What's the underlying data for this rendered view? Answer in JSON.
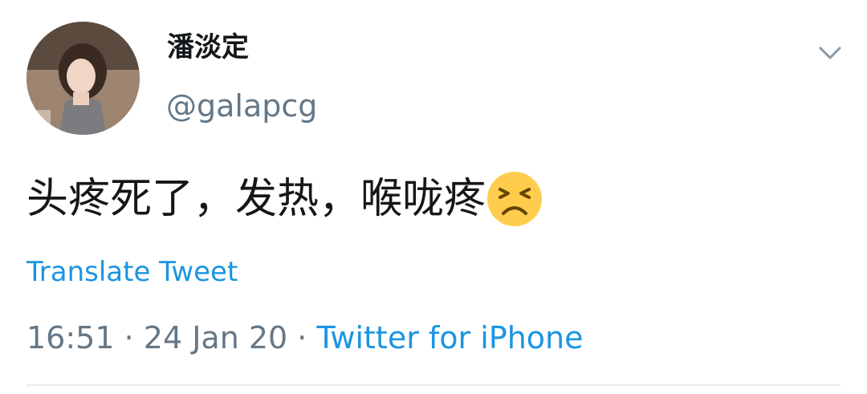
{
  "tweet": {
    "user": {
      "display_name": "潘淡定",
      "handle": "@galapcg",
      "avatar_icon": "user-avatar-photo"
    },
    "menu_icon": "chevron-down-icon",
    "text": "头疼死了，发热，喉咙疼",
    "emoji_icon": "persevering-face-emoji",
    "translate_label": "Translate Tweet",
    "meta": {
      "time": "16:51",
      "separator": " · ",
      "date": "24 Jan 20",
      "source": "Twitter for iPhone"
    }
  },
  "colors": {
    "text": "#14171a",
    "secondary": "#657786",
    "link": "#1b95e0",
    "divider": "#e6ecf0"
  }
}
